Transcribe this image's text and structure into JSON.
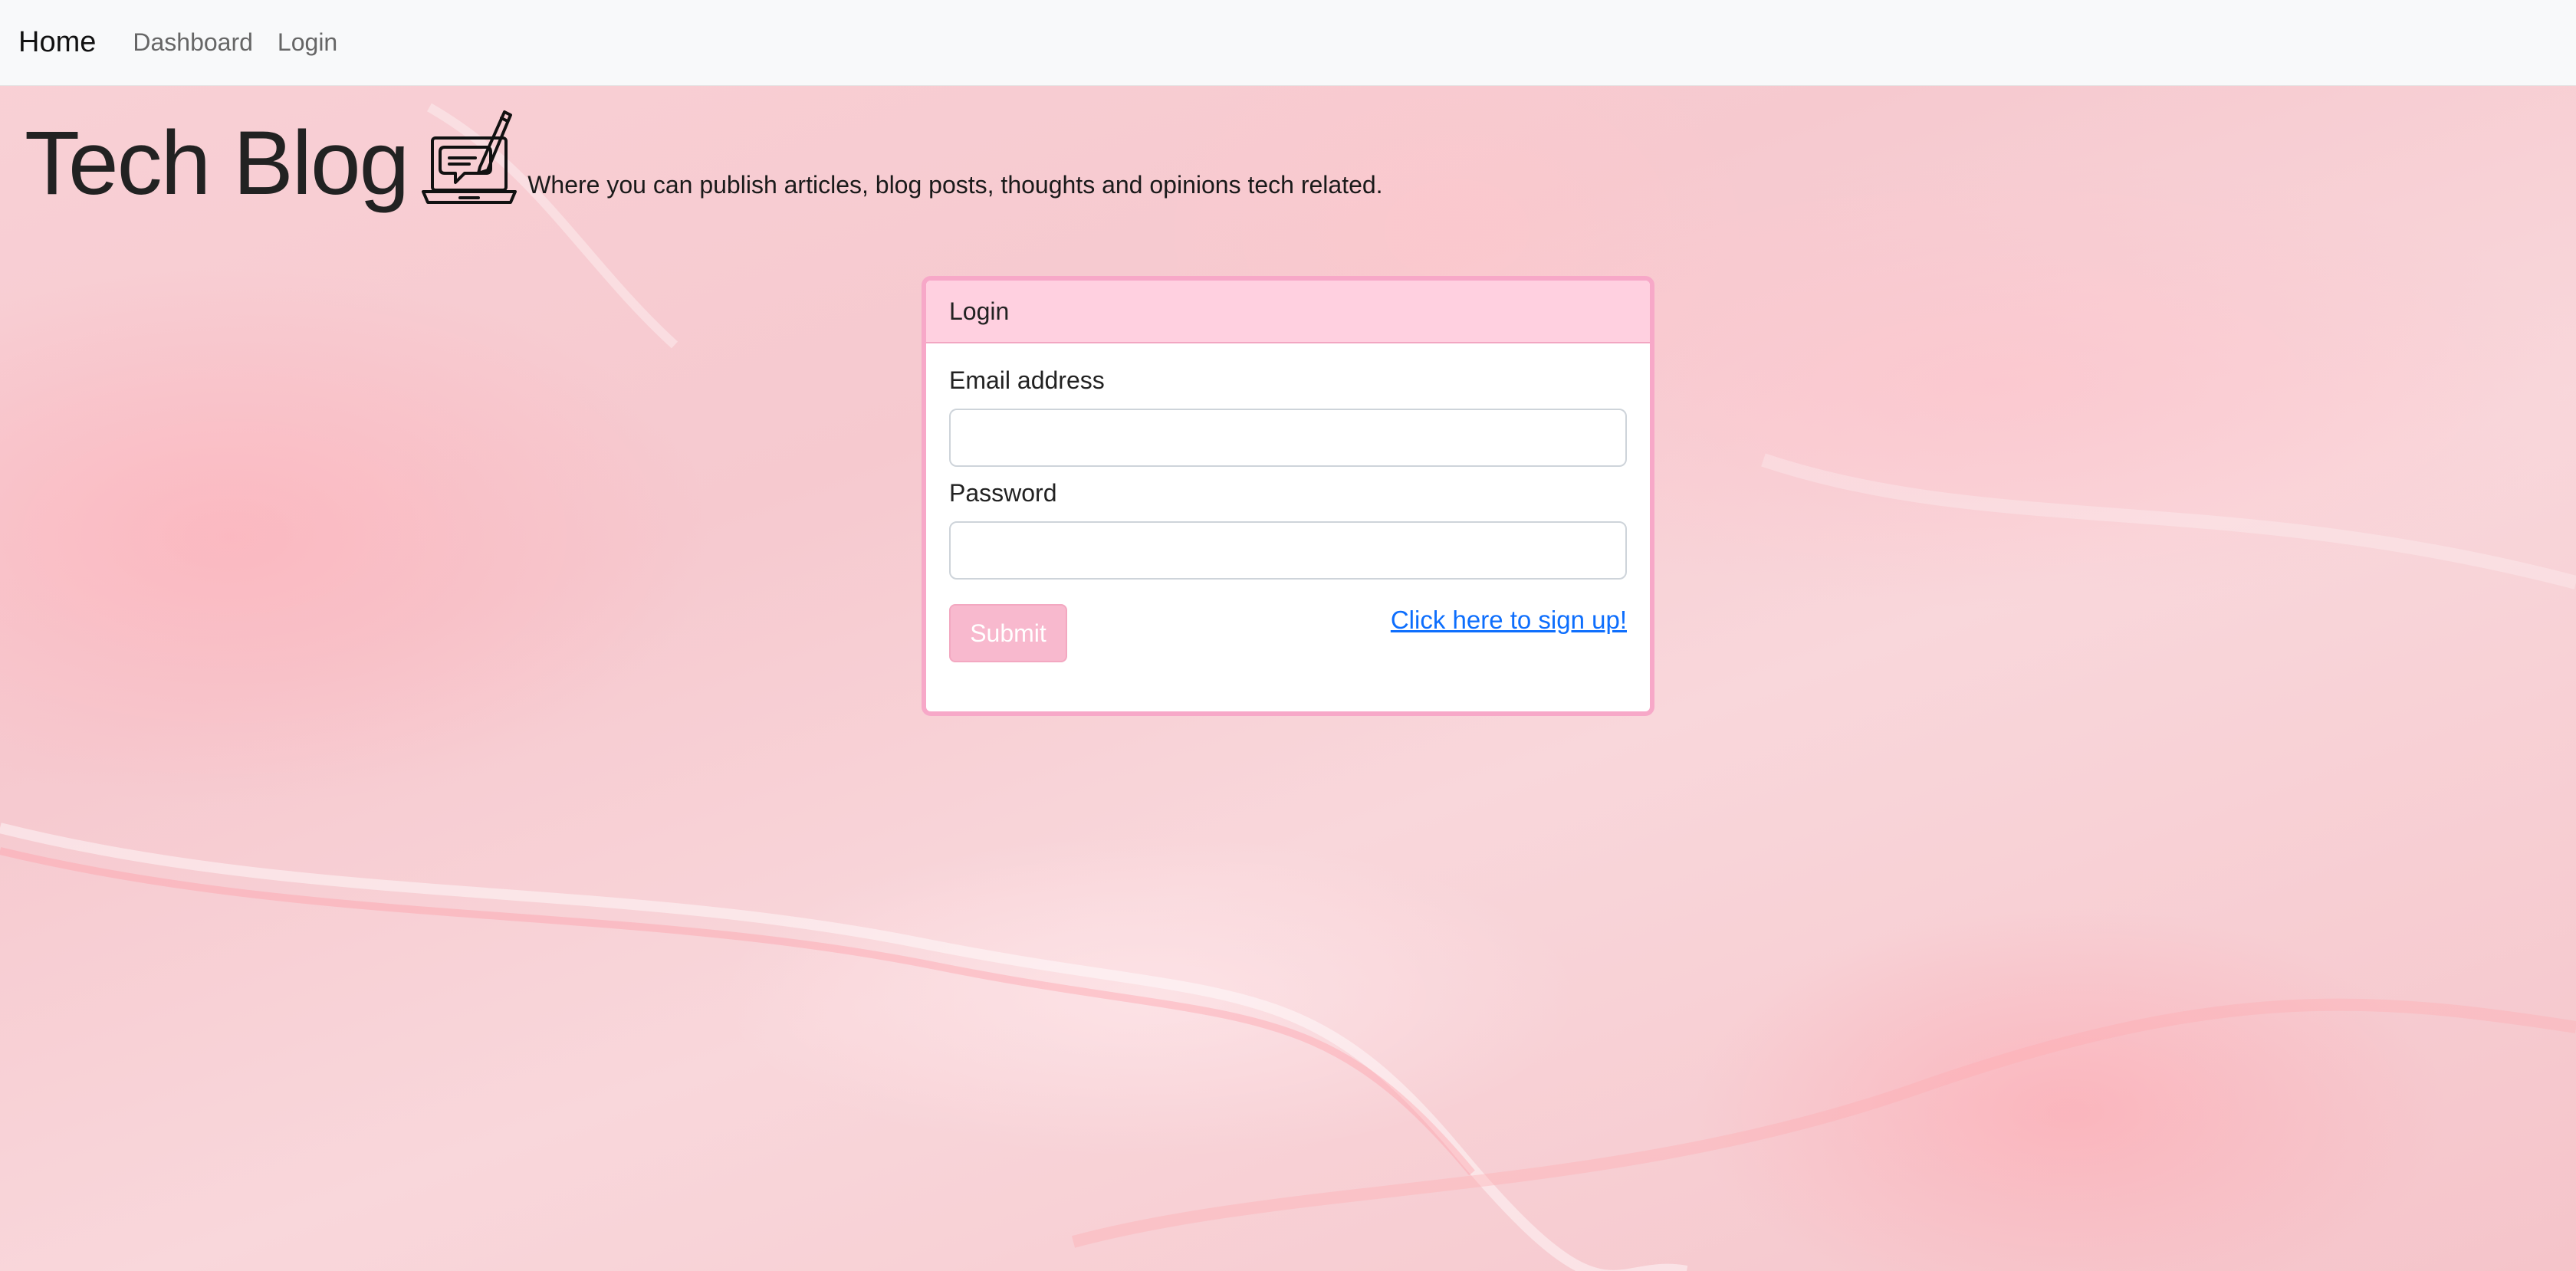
{
  "navbar": {
    "brand": "Home",
    "links": [
      "Dashboard",
      "Login"
    ]
  },
  "header": {
    "title": "Tech Blog",
    "logo_icon": "laptop-chat-pen-icon",
    "tagline": "Where you can publish articles, blog posts, thoughts and opinions tech related."
  },
  "login_card": {
    "title": "Login",
    "email_label": "Email address",
    "email_value": "",
    "password_label": "Password",
    "password_value": "",
    "submit_label": "Submit",
    "signup_link": "Click here to sign up!"
  },
  "colors": {
    "card_border": "#f7a8c8",
    "card_header_bg": "#ffd0e0",
    "submit_bg": "#f8b9ce",
    "link": "#0d6efd",
    "background": "#f7ccd2"
  }
}
